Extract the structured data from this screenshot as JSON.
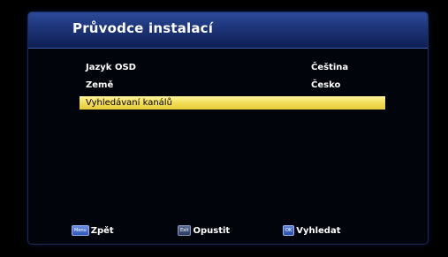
{
  "header": {
    "title": "Průvodce instalací"
  },
  "menu": {
    "items": [
      {
        "label": "Jazyk OSD",
        "value": "Čeština"
      },
      {
        "label": "Země",
        "value": "Česko"
      },
      {
        "label": "Vyhledávaní kanálů",
        "value": "",
        "selected": true
      }
    ]
  },
  "footer": {
    "back": {
      "key": "Menu",
      "label": "Zpět"
    },
    "exit": {
      "key": "Exit",
      "label": "Opustit"
    },
    "search": {
      "key": "OK",
      "label": "Vyhledat"
    }
  },
  "colors": {
    "header_blue": "#1d3478",
    "highlight_yellow": "#f2dd55",
    "background": "#000000",
    "text": "#ffffff"
  }
}
